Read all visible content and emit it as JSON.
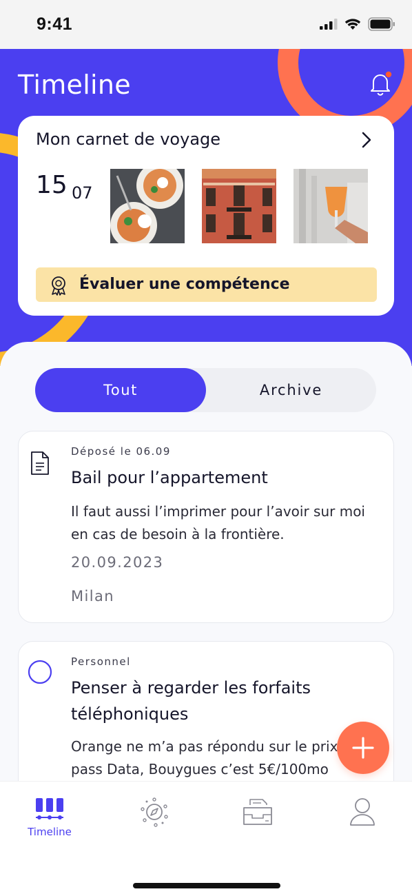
{
  "status_bar": {
    "time": "9:41"
  },
  "header": {
    "title": "Timeline"
  },
  "carnet": {
    "title": "Mon carnet de voyage",
    "day": "15",
    "month": "07",
    "skill_button_label": "Évaluer une compétence"
  },
  "segment": {
    "active": "Tout",
    "inactive": "Archive"
  },
  "cards": [
    {
      "tag": "Déposé le 06.09",
      "title": "Bail pour l’appartement",
      "body": "Il faut aussi l’imprimer pour l’avoir sur moi en cas de besoin à la frontière.",
      "date": "20.09.2023",
      "place": "Milan",
      "icon": "document-icon"
    },
    {
      "tag": "Personnel",
      "title": "Penser à regarder les forfaits téléphoniques",
      "body": "Orange ne m’a pas répondu sur le prix du pass Data, Bouygues c’est 5€/100mo",
      "icon": "circle-checkbox-icon"
    }
  ],
  "tabbar": {
    "items": [
      {
        "label": "Timeline",
        "icon": "timeline-icon",
        "active": true
      },
      {
        "label": "",
        "icon": "explore-compass-icon",
        "active": false
      },
      {
        "label": "",
        "icon": "inbox-tray-icon",
        "active": false
      },
      {
        "label": "",
        "icon": "profile-icon",
        "active": false
      }
    ]
  },
  "colors": {
    "primary": "#4b3ff0",
    "accent_orange": "#ff7250",
    "accent_yellow": "#fbb82b",
    "skill_button_bg": "#fbe3a6"
  }
}
